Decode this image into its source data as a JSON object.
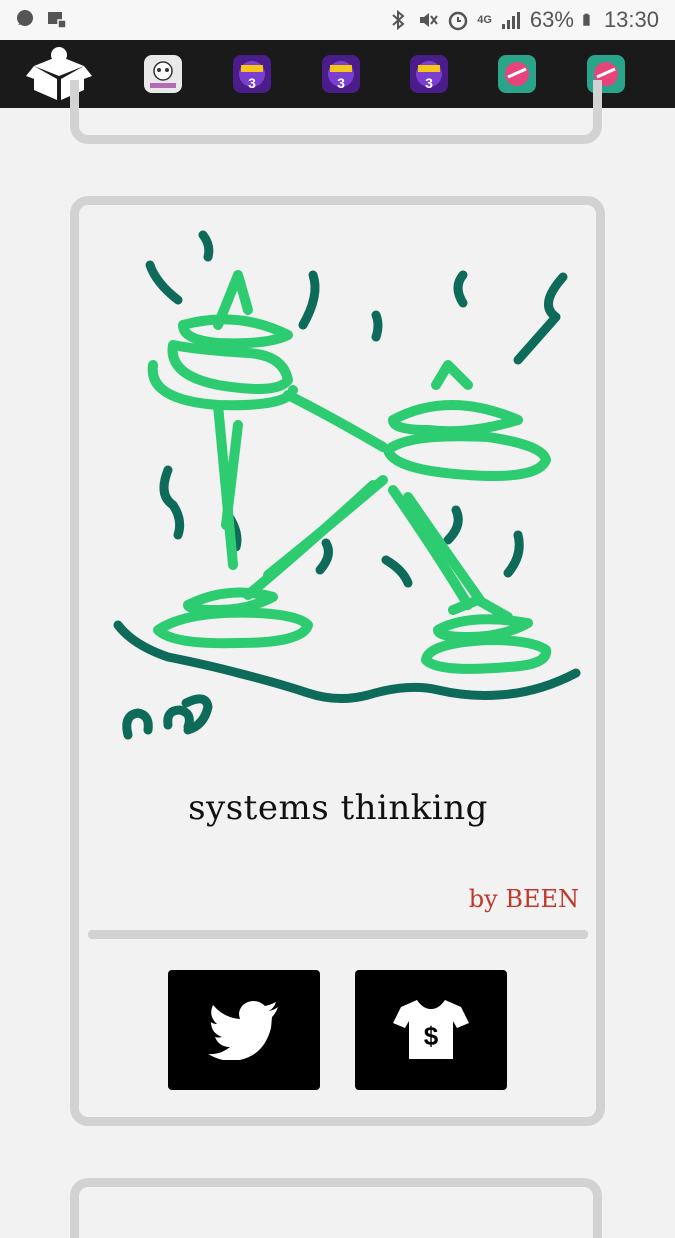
{
  "status_bar": {
    "battery": "63%",
    "time": "13:30",
    "network": "4G"
  },
  "app_bar": {
    "logo_icon": "jackbox-box-icon",
    "games": [
      {
        "name": "drawful-2-icon",
        "label": "drawful2"
      },
      {
        "name": "quiplash-icon"
      },
      {
        "name": "quiplash-icon"
      },
      {
        "name": "quiplash-icon"
      },
      {
        "name": "ko-game-icon"
      },
      {
        "name": "ko-game-icon"
      }
    ]
  },
  "card": {
    "title": "systems thinking",
    "artist": "by BEEN"
  },
  "buttons": {
    "twitter_icon": "twitter-bird-icon",
    "shop_icon": "tshirt-dollar-icon"
  },
  "colors": {
    "stroke_light": "#2ecc71",
    "stroke_dark": "#0e6b5a",
    "artist": "#c2392b",
    "app_bar": "#1a1a1a",
    "frame": "#d2d2d2"
  }
}
